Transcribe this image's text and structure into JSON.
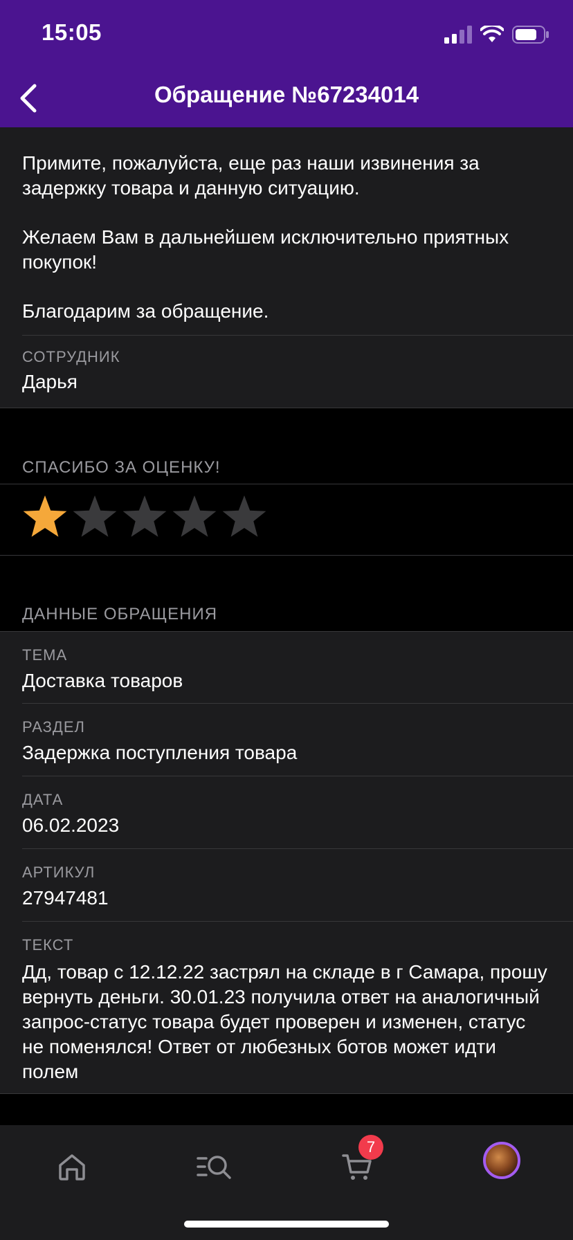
{
  "status_bar": {
    "time": "15:05"
  },
  "nav": {
    "title": "Обращение №67234014"
  },
  "message": {
    "paragraphs": [
      "Примите, пожалуйста, еще раз наши извинения за задержку товара и данную ситуацию.",
      "Желаем Вам в дальнейшем исключительно приятных покупок!",
      "Благодарим за обращение."
    ],
    "employee_caption": "СОТРУДНИК",
    "employee_name": "Дарья"
  },
  "rating": {
    "title": "СПАСИБО ЗА ОЦЕНКУ!",
    "value": 1,
    "max": 5,
    "active_color": "#f5a83a",
    "inactive_color": "#3a3a3c"
  },
  "details": {
    "title": "ДАННЫЕ ОБРАЩЕНИЯ",
    "fields": [
      {
        "caption": "ТЕМА",
        "value": "Доставка товаров"
      },
      {
        "caption": "РАЗДЕЛ",
        "value": "Задержка поступления товара"
      },
      {
        "caption": "ДАТА",
        "value": "06.02.2023"
      },
      {
        "caption": "АРТИКУЛ",
        "value": "27947481"
      },
      {
        "caption": "ТЕКСТ",
        "value": "Дд, товар с 12.12.22 застрял на складе в г Самара, прошу вернуть деньги. 30.01.23 получила ответ на аналогичный запрос-статус товара будет проверен и изменен, статус не поменялся! Ответ от любезных ботов может идти полем"
      }
    ]
  },
  "tabbar": {
    "items": [
      {
        "icon": "home-icon"
      },
      {
        "icon": "catalog-search-icon"
      },
      {
        "icon": "cart-icon"
      },
      {
        "icon": "profile-avatar"
      }
    ],
    "cart_badge": "7"
  },
  "colors": {
    "header": "#4b1490",
    "card": "#1c1c1e",
    "background": "#000000",
    "accent_star": "#f5a83a",
    "badge": "#f23b4c"
  }
}
